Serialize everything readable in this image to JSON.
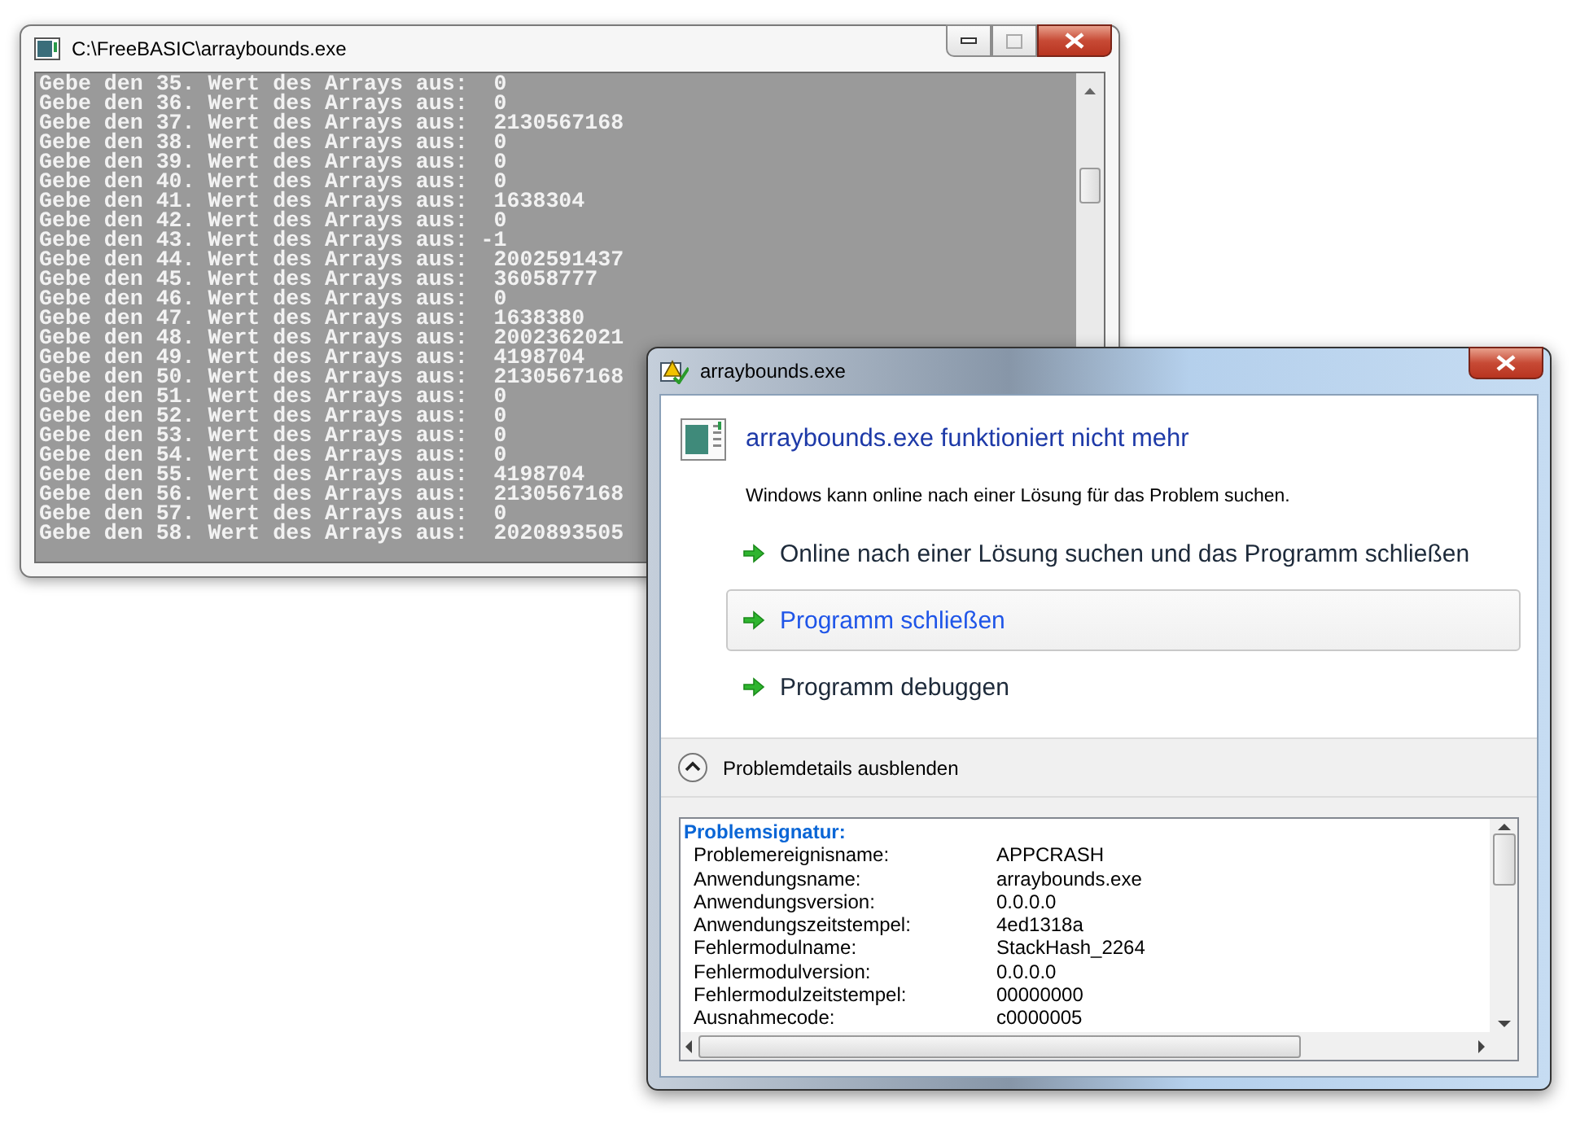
{
  "console_window": {
    "title": "C:\\FreeBASIC\\arraybounds.exe",
    "lines": [
      "Gebe den 35. Wert des Arrays aus:  0",
      "Gebe den 36. Wert des Arrays aus:  0",
      "Gebe den 37. Wert des Arrays aus:  2130567168",
      "Gebe den 38. Wert des Arrays aus:  0",
      "Gebe den 39. Wert des Arrays aus:  0",
      "Gebe den 40. Wert des Arrays aus:  0",
      "Gebe den 41. Wert des Arrays aus:  1638304",
      "Gebe den 42. Wert des Arrays aus:  0",
      "Gebe den 43. Wert des Arrays aus: -1",
      "Gebe den 44. Wert des Arrays aus:  2002591437",
      "Gebe den 45. Wert des Arrays aus:  36058777",
      "Gebe den 46. Wert des Arrays aus:  0",
      "Gebe den 47. Wert des Arrays aus:  1638380",
      "Gebe den 48. Wert des Arrays aus:  2002362021",
      "Gebe den 49. Wert des Arrays aus:  4198704",
      "Gebe den 50. Wert des Arrays aus:  2130567168",
      "Gebe den 51. Wert des Arrays aus:  0",
      "Gebe den 52. Wert des Arrays aus:  0",
      "Gebe den 53. Wert des Arrays aus:  0",
      "Gebe den 54. Wert des Arrays aus:  0",
      "Gebe den 55. Wert des Arrays aus:  4198704",
      "Gebe den 56. Wert des Arrays aus:  2130567168",
      "Gebe den 57. Wert des Arrays aus:  0",
      "Gebe den 58. Wert des Arrays aus:  2020893505"
    ]
  },
  "error_dialog": {
    "title": "arraybounds.exe",
    "heading": "arraybounds.exe funktioniert nicht mehr",
    "message": "Windows kann online nach einer Lösung für das Problem suchen.",
    "options": [
      {
        "label": "Online nach einer Lösung suchen und das Programm schließen",
        "selected": false
      },
      {
        "label": "Programm schließen",
        "selected": true
      },
      {
        "label": "Programm debuggen",
        "selected": false
      }
    ],
    "details_toggle": {
      "label": "Problemdetails ausblenden",
      "expanded": true
    },
    "details": {
      "section_title": "Problemsignatur:",
      "rows": [
        {
          "name": "Problemereignisname:",
          "value": "APPCRASH"
        },
        {
          "name": "Anwendungsname:",
          "value": "arraybounds.exe"
        },
        {
          "name": "Anwendungsversion:",
          "value": "0.0.0.0"
        },
        {
          "name": "Anwendungszeitstempel:",
          "value": "4ed1318a"
        },
        {
          "name": "Fehlermodulname:",
          "value": "StackHash_2264"
        },
        {
          "name": "Fehlermodulversion:",
          "value": "0.0.0.0"
        },
        {
          "name": "Fehlermodulzeitstempel:",
          "value": "00000000"
        },
        {
          "name": "Ausnahmecode:",
          "value": "c0000005"
        }
      ]
    }
  }
}
